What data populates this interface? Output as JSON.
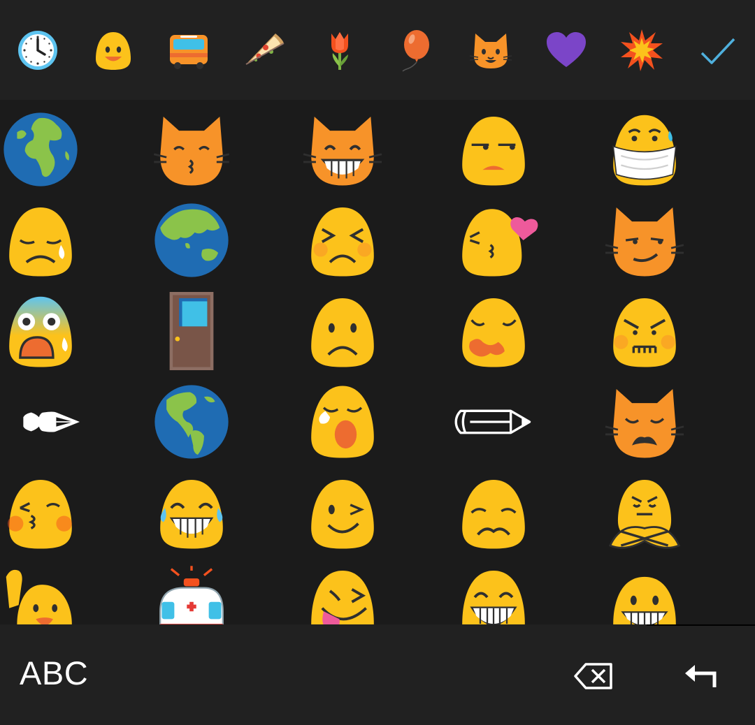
{
  "tabs": [
    {
      "name": "recent-tab",
      "icon": "clock-icon"
    },
    {
      "name": "smileys-tab",
      "icon": "smiley-icon"
    },
    {
      "name": "travel-tab",
      "icon": "bus-icon"
    },
    {
      "name": "food-tab",
      "icon": "pizza-icon"
    },
    {
      "name": "nature-tab",
      "icon": "tulip-icon"
    },
    {
      "name": "objects-tab",
      "icon": "balloon-icon"
    },
    {
      "name": "animals-tab",
      "icon": "cat-icon"
    },
    {
      "name": "symbols-tab",
      "icon": "heart-icon"
    },
    {
      "name": "flags-tab",
      "icon": "collision-icon"
    },
    {
      "name": "done-tab",
      "icon": "checkmark-icon",
      "color": "#4fb0dd"
    }
  ],
  "emoji_grid": [
    [
      "globe-europe-africa",
      "kissing-cat",
      "grinning-cat",
      "unamused-face",
      "face-with-mask"
    ],
    [
      "disappointed-relieved-face",
      "globe-asia-australia",
      "persevering-face",
      "face-blowing-kiss",
      "smirking-cat"
    ],
    [
      "face-screaming-in-fear",
      "door",
      "frowning-face",
      "confounded-face",
      "angry-face"
    ],
    [
      "fountain-pen",
      "globe-americas",
      "sleepy-face",
      "pencil",
      "weary-cat"
    ],
    [
      "kissing-face-closed-eyes",
      "face-with-tears-of-joy",
      "winking-face",
      "worried-face",
      "no-good-gesture"
    ],
    [
      "raising-hand",
      "ambulance",
      "squinting-tongue-face",
      "grinning-face",
      "grinning-face-big"
    ]
  ],
  "colors": {
    "emoji_yellow": "#fcc21b",
    "cat_orange": "#f79329",
    "check_blue": "#4fb0dd"
  },
  "bottom_bar": {
    "abc_label": "ABC",
    "backspace_icon": "backspace-icon",
    "enter_icon": "enter-icon"
  }
}
